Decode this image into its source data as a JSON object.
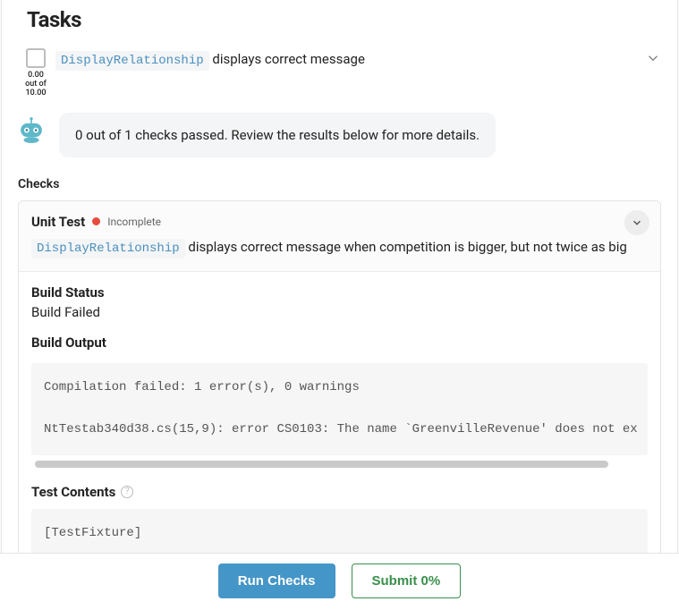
{
  "page_title": "Tasks",
  "task": {
    "code_name": "DisplayRelationship",
    "suffix": "displays correct message",
    "score_value": "0.00",
    "score_label": "out of",
    "score_max": "10.00"
  },
  "bot_message": "0 out of 1 checks passed. Review the results below for more details.",
  "checks_label": "Checks",
  "unit_test": {
    "name": "Unit Test",
    "status": "Incomplete",
    "code_name": "DisplayRelationship",
    "desc_suffix": "displays correct message when competition is bigger, but not twice as big"
  },
  "build_status": {
    "label": "Build Status",
    "value": "Build Failed"
  },
  "build_output": {
    "label": "Build Output",
    "text": "Compilation failed: 1 error(s), 0 warnings\n\nNtTestab340d38.cs(15,9): error CS0103: The name `GreenvilleRevenue' does not ex"
  },
  "test_contents": {
    "label": "Test Contents",
    "text": "[TestFixture]"
  },
  "footer": {
    "run_checks": "Run Checks",
    "submit": "Submit 0%"
  }
}
